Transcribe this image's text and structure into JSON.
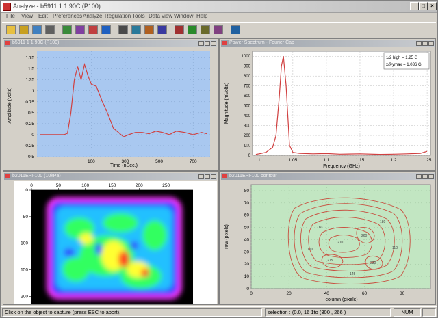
{
  "window": {
    "title": "Analyze - b5911 1 1.90C (P100)"
  },
  "menu": [
    "File",
    "View",
    "Edit",
    "Preferences",
    "Analyze",
    "Regulation",
    "Tools",
    "Data view",
    "Window",
    "Help"
  ],
  "toolbar": {
    "buttons": [
      "new",
      "open",
      "save",
      "print",
      "copy",
      "paste",
      "cut",
      "zoom",
      "pan",
      "chart",
      "grid",
      "cursor",
      "layer",
      "palette",
      "measure",
      "export",
      "help"
    ]
  },
  "panels": {
    "time": {
      "title": "b5911 1 1.90C (P100)",
      "ylabel": "Amplitude (Volts)",
      "xlabel": "Time (nSec.)",
      "yticks": [
        "1.75",
        "1.5",
        "1.25",
        "1",
        "0.75",
        "0.5",
        "0.25",
        "0",
        "-0.25",
        "-0.5"
      ],
      "xticks": [
        "100",
        "300",
        "500",
        "700"
      ]
    },
    "power": {
      "title": "Power Spectrum - Fourier Cap",
      "ylabel": "Magnitude (mVolts)",
      "xlabel": "Frequency (GHz)",
      "yticks": [
        "1000",
        "900",
        "800",
        "700",
        "600",
        "500",
        "400",
        "300",
        "200",
        "100",
        "0"
      ],
      "xticks": [
        "1",
        "1.05",
        "1.1",
        "1.15",
        "1.2",
        "1.25"
      ],
      "annotation": {
        "line1": "1/2 high  = 1.25 G",
        "line2": "x@ymax = 1.036 G"
      }
    },
    "heatmap": {
      "title": "b2011EPI-100 (10kPa)",
      "xticks": [
        "0",
        "50",
        "100",
        "150",
        "200",
        "250"
      ],
      "yticks": [
        "0",
        "50",
        "100",
        "150",
        "200"
      ]
    },
    "contour": {
      "title": "b2011EPI-100 contour",
      "ylabel": "row (pixels)",
      "xlabel": "column (pixels)",
      "yticks": [
        "0",
        "10",
        "20",
        "30",
        "40",
        "50",
        "60",
        "70",
        "80"
      ],
      "xticks": [
        "0",
        "20",
        "40",
        "60",
        "80"
      ]
    }
  },
  "status": {
    "hint": "Click on the object to capture (press ESC to abort).",
    "selection": "selection : (0.0, 16 1to (300 , 266 )",
    "num": "NUM"
  },
  "colors": {
    "time_bg": "#a9c8f0",
    "power_bg": "#ffffff",
    "contour_bg": "#c2e6c2",
    "trace": "#d04040"
  },
  "chart_data": [
    {
      "type": "line",
      "x": [
        -200,
        -150,
        -100,
        -60,
        -40,
        -20,
        0,
        20,
        40,
        60,
        80,
        100,
        130,
        160,
        200,
        230,
        260,
        290,
        320,
        360,
        400,
        440,
        480,
        520,
        560,
        600,
        650,
        700,
        750,
        780
      ],
      "y": [
        0.0,
        0.0,
        0.0,
        0.0,
        0.03,
        0.5,
        1.25,
        1.55,
        1.25,
        1.6,
        1.35,
        1.15,
        1.1,
        0.8,
        0.45,
        0.15,
        0.05,
        -0.05,
        0.0,
        0.05,
        0.05,
        0.02,
        0.08,
        0.05,
        0.0,
        0.08,
        0.05,
        0.0,
        0.05,
        0.02
      ],
      "xlabel": "Time (nSec.)",
      "ylabel": "Amplitude (Volts)",
      "xlim": [
        -220,
        800
      ],
      "ylim": [
        -0.5,
        1.9
      ],
      "grid": true
    },
    {
      "type": "line",
      "x": [
        0.995,
        1.0,
        1.01,
        1.02,
        1.025,
        1.03,
        1.033,
        1.036,
        1.04,
        1.045,
        1.05,
        1.06,
        1.08,
        1.1,
        1.12,
        1.15,
        1.18,
        1.2,
        1.22,
        1.24,
        1.25
      ],
      "y": [
        10,
        15,
        30,
        80,
        200,
        600,
        900,
        1000,
        700,
        100,
        30,
        20,
        15,
        18,
        12,
        15,
        10,
        12,
        15,
        20,
        40
      ],
      "xlabel": "Frequency (GHz)",
      "ylabel": "Magnitude (mVolts)",
      "xlim": [
        0.99,
        1.255
      ],
      "ylim": [
        0,
        1050
      ],
      "annotation": [
        "1/2 high  = 1.25 G",
        "x@ymax = 1.036 G"
      ],
      "grid": true
    },
    {
      "type": "heatmap",
      "xlim": [
        0,
        300
      ],
      "ylim": [
        0,
        215
      ],
      "colormap": "rainbow"
    },
    {
      "type": "line",
      "xlabel": "column (pixels)",
      "ylabel": "row (pixels)",
      "xlim": [
        0,
        95
      ],
      "ylim": [
        0,
        85
      ]
    }
  ]
}
